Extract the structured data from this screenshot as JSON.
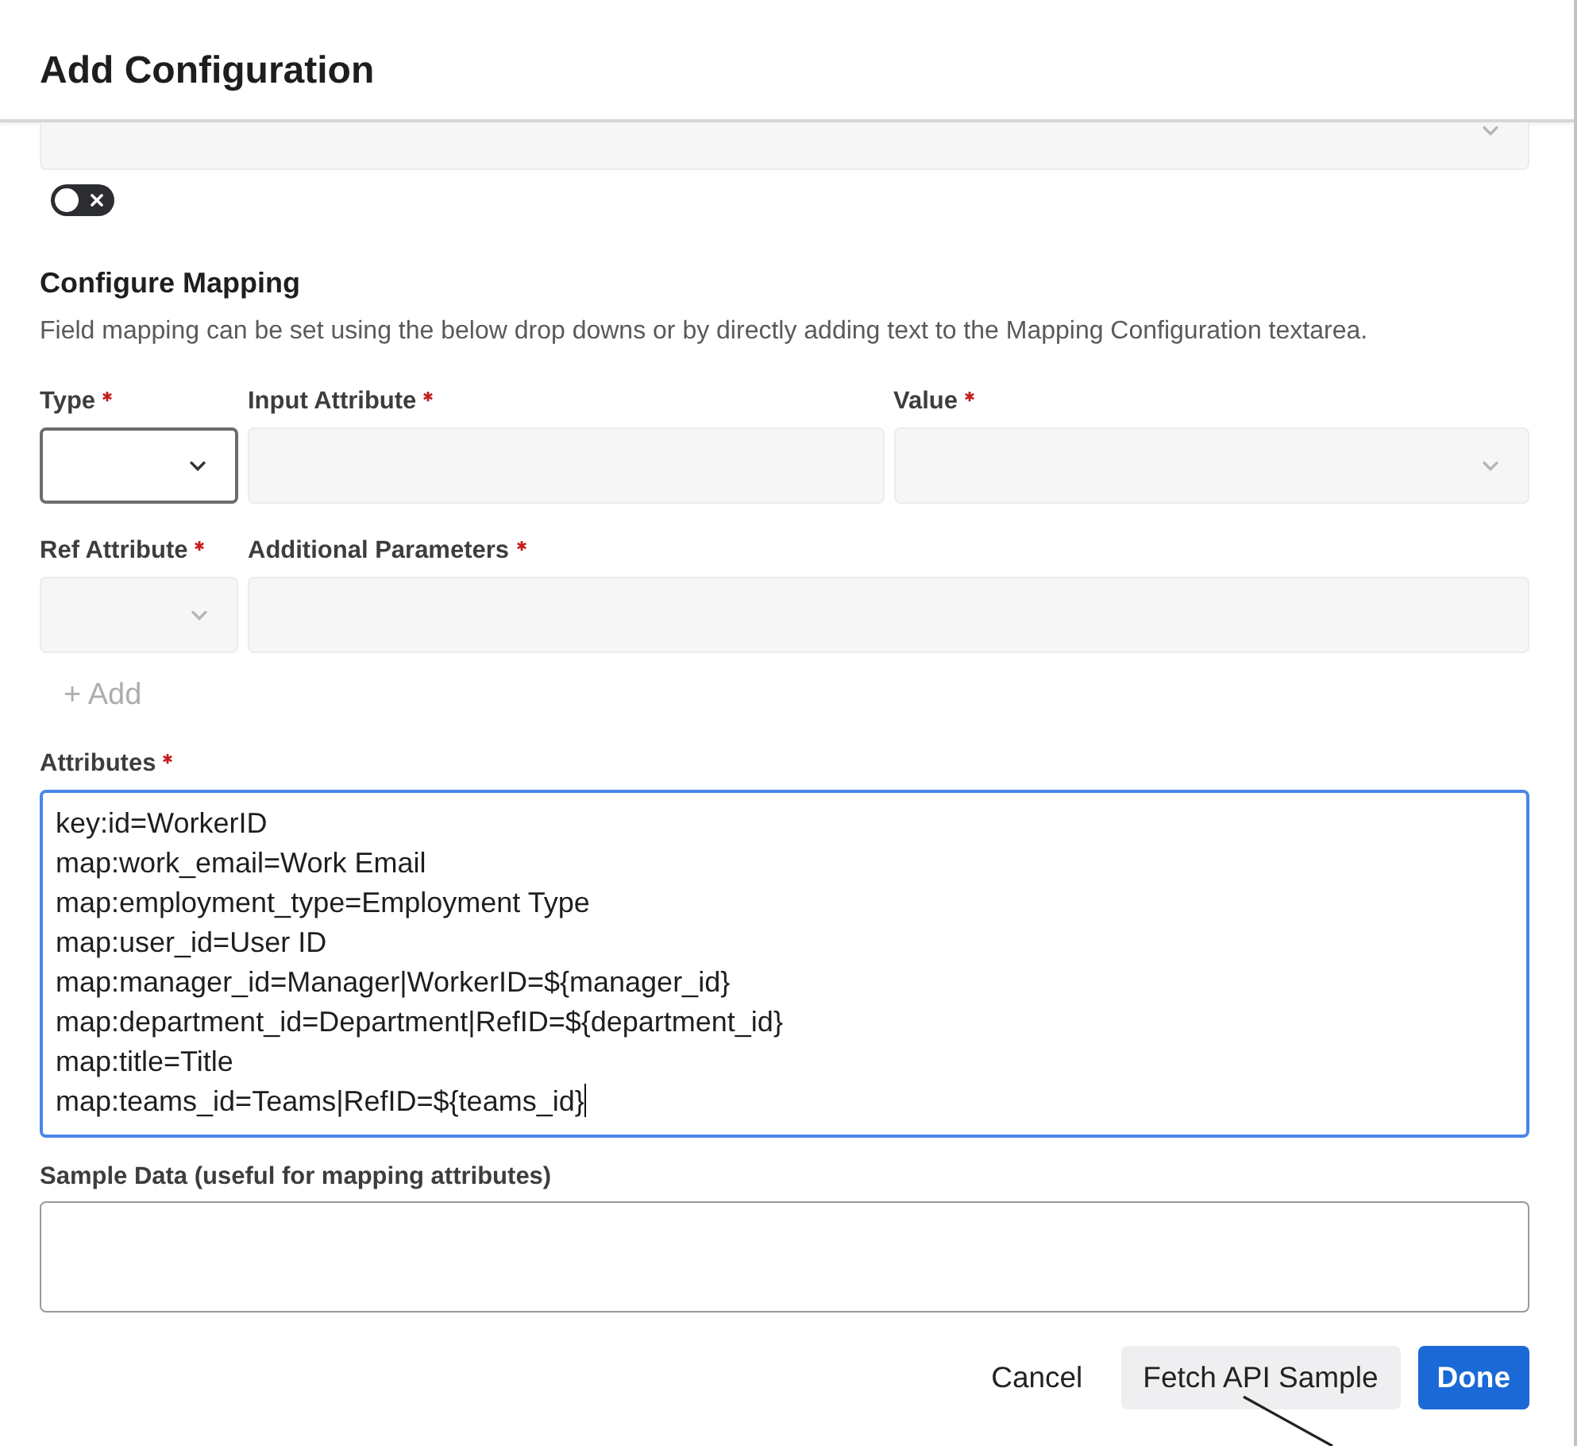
{
  "dialog": {
    "title": "Add Configuration"
  },
  "toggle": {
    "on": false
  },
  "mapping": {
    "title": "Configure Mapping",
    "description": "Field mapping can be set using the below drop downs or by directly adding text to the Mapping Configuration textarea.",
    "rows": [
      {
        "fields": [
          {
            "label": "Type",
            "required": true,
            "kind": "select",
            "focused": true
          },
          {
            "label": "Input Attribute",
            "required": true,
            "kind": "input",
            "focused": false
          },
          {
            "label": "Value",
            "required": true,
            "kind": "select",
            "focused": false
          }
        ]
      },
      {
        "fields": [
          {
            "label": "Ref Attribute",
            "required": true,
            "kind": "select",
            "focused": false
          },
          {
            "label": "Additional Parameters",
            "required": true,
            "kind": "input",
            "focused": false
          }
        ]
      }
    ],
    "add_button": {
      "label": "+ Add",
      "disabled": true
    }
  },
  "attributes": {
    "label": "Attributes",
    "required": true,
    "focused": true,
    "value": "key:id=WorkerID\nmap:work_email=Work Email\nmap:employment_type=Employment Type\nmap:user_id=User ID\nmap:manager_id=Manager|WorkerID=${manager_id}\nmap:department_id=Department|RefID=${department_id}\nmap:title=Title\nmap:teams_id=Teams|RefID=${teams_id}"
  },
  "sample_data": {
    "label": "Sample Data (useful for mapping attributes)",
    "required": false,
    "focused": false
  },
  "buttons": [
    {
      "label": "Cancel",
      "kind": "text"
    },
    {
      "label": "Fetch API Sample",
      "kind": "secondary"
    },
    {
      "label": "Done",
      "kind": "primary"
    }
  ]
}
